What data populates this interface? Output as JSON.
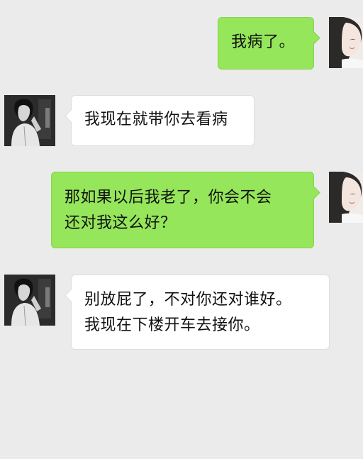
{
  "colors": {
    "background": "#ebebeb",
    "sent_bubble": "#95e65a",
    "received_bubble": "#ffffff"
  },
  "messages": [
    {
      "sender": "self",
      "text": "我病了。"
    },
    {
      "sender": "other",
      "text": "我现在就带你去看病"
    },
    {
      "sender": "self",
      "text": "那如果以后我老了，你会不会\n还对我这么好？"
    },
    {
      "sender": "other",
      "text": "别放屁了，不对你还对谁好。\n我现在下楼开车去接你。"
    }
  ]
}
